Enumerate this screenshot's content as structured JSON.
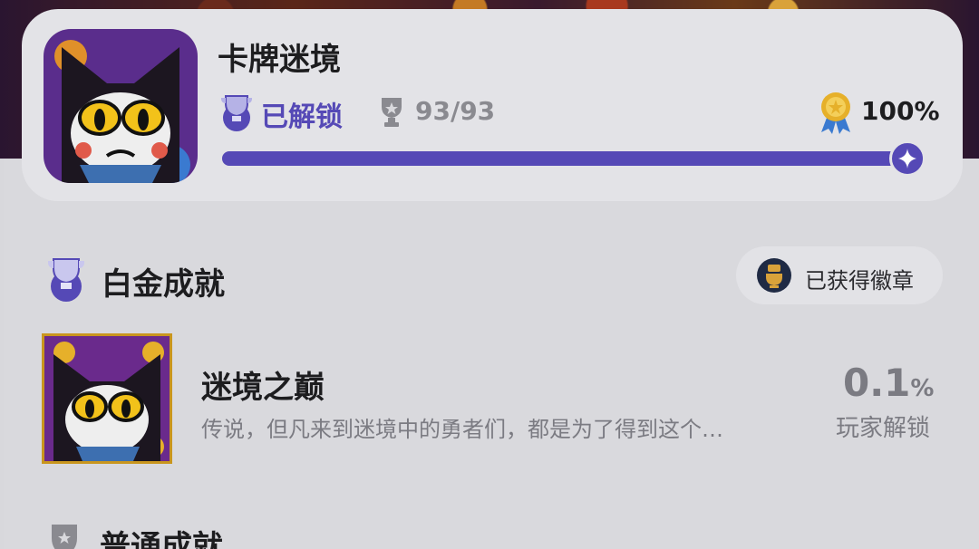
{
  "game": {
    "title": "卡牌迷境",
    "unlock_status": "已解锁",
    "trophy_count": "93/93",
    "completion_text": "100%",
    "completion_fraction": 1.0
  },
  "sections": {
    "platinum": {
      "title": "白金成就",
      "badge_button": "已获得徽章",
      "achievement": {
        "title": "迷境之巅",
        "description": "传说，但凡来到迷境中的勇者们，都是为了得到这个…",
        "rate_value": "0.1",
        "rate_unit": "%",
        "rate_label": "玩家解锁"
      }
    },
    "normal": {
      "title": "普通成就"
    }
  },
  "colors": {
    "accent": "#5549b6",
    "gold_border": "#c9961e",
    "muted_text": "#7b7b82",
    "card_bg": "#e3e3e7",
    "page_bg": "#d9d9dd"
  },
  "icons": {
    "unlock": "platinum-trophy-icon",
    "trophy": "trophy-icon",
    "medal": "medal-icon",
    "platinum": "platinum-trophy-icon",
    "badge": "badge-icon",
    "normal": "shield-trophy-icon",
    "progress_knob": "sparkle-icon"
  }
}
